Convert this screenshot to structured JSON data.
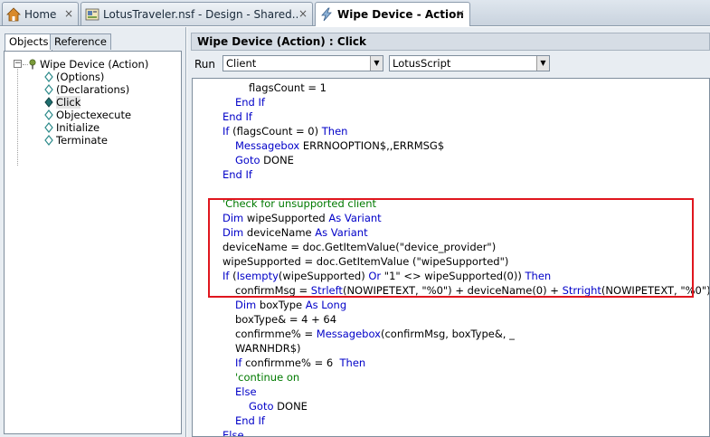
{
  "tabs": [
    {
      "label": "Home",
      "icon": "home-icon"
    },
    {
      "label": "LotusTraveler.nsf - Design - Shared...",
      "icon": "database-icon"
    },
    {
      "label": "Wipe Device - Action",
      "icon": "lightning-icon"
    }
  ],
  "left_panel": {
    "tabs": [
      "Objects",
      "Reference"
    ],
    "tree": {
      "root": "Wipe Device (Action)",
      "children": [
        "(Options)",
        "(Declarations)",
        "Click",
        "Objectexecute",
        "Initialize",
        "Terminate"
      ],
      "selected": "Click"
    }
  },
  "editor": {
    "title": "Wipe Device (Action) : Click",
    "run_label": "Run",
    "run_value": "Client",
    "language_value": "LotusScript"
  },
  "code_lines": [
    [
      {
        "t": "flagsCount = 1",
        "c": "n"
      }
    ],
    [
      {
        "t": "End If",
        "c": "k"
      }
    ],
    [
      {
        "t": "End If",
        "c": "k"
      }
    ],
    [
      {
        "t": "If",
        "c": "k"
      },
      {
        "t": " (flagsCount = 0) ",
        "c": "n"
      },
      {
        "t": "Then",
        "c": "k"
      }
    ],
    [
      {
        "t": "Messagebox",
        "c": "k"
      },
      {
        "t": " ERRNOOPTION$,,ERRMSG$",
        "c": "n"
      }
    ],
    [
      {
        "t": "Goto",
        "c": "k"
      },
      {
        "t": " DONE",
        "c": "n"
      }
    ],
    [
      {
        "t": "End If",
        "c": "k"
      }
    ],
    [],
    [
      {
        "t": "'Check for unsupported client",
        "c": "c"
      }
    ],
    [
      {
        "t": "Dim",
        "c": "k"
      },
      {
        "t": " wipeSupported ",
        "c": "n"
      },
      {
        "t": "As Variant",
        "c": "k"
      }
    ],
    [
      {
        "t": "Dim",
        "c": "k"
      },
      {
        "t": " deviceName ",
        "c": "n"
      },
      {
        "t": "As Variant",
        "c": "k"
      }
    ],
    [
      {
        "t": "deviceName = doc.GetItemValue(\"device_provider\")",
        "c": "n"
      }
    ],
    [
      {
        "t": "wipeSupported = doc.GetItemValue (\"wipeSupported\")",
        "c": "n"
      }
    ],
    [
      {
        "t": "If",
        "c": "k"
      },
      {
        "t": " (",
        "c": "n"
      },
      {
        "t": "Isempty",
        "c": "k"
      },
      {
        "t": "(wipeSupported) ",
        "c": "n"
      },
      {
        "t": "Or",
        "c": "k"
      },
      {
        "t": " \"1\" <> wipeSupported(0)) ",
        "c": "n"
      },
      {
        "t": "Then",
        "c": "k"
      }
    ],
    [
      {
        "t": "confirmMsg = ",
        "c": "n"
      },
      {
        "t": "Strleft",
        "c": "k"
      },
      {
        "t": "(NOWIPETEXT, \"%0\") + deviceName(0) + ",
        "c": "n"
      },
      {
        "t": "Strright",
        "c": "k"
      },
      {
        "t": "(NOWIPETEXT, \"%0\")",
        "c": "n"
      }
    ],
    [
      {
        "t": "Dim",
        "c": "k"
      },
      {
        "t": " boxType ",
        "c": "n"
      },
      {
        "t": "As Long",
        "c": "k"
      }
    ],
    [
      {
        "t": "boxType& = 4 + 64",
        "c": "n"
      }
    ],
    [
      {
        "t": "confirmme% = ",
        "c": "n"
      },
      {
        "t": "Messagebox",
        "c": "k"
      },
      {
        "t": "(confirmMsg, boxType&, _",
        "c": "n"
      }
    ],
    [
      {
        "t": "WARNHDR$)",
        "c": "n"
      }
    ],
    [
      {
        "t": "If",
        "c": "k"
      },
      {
        "t": " confirmme% = 6  ",
        "c": "n"
      },
      {
        "t": "Then",
        "c": "k"
      }
    ],
    [
      {
        "t": "'continue on",
        "c": "c"
      }
    ],
    [
      {
        "t": "Else",
        "c": "k"
      }
    ],
    [
      {
        "t": "Goto",
        "c": "k"
      },
      {
        "t": " DONE",
        "c": "n"
      }
    ],
    [
      {
        "t": "End If",
        "c": "k"
      }
    ],
    [
      {
        "t": "Else",
        "c": "k"
      }
    ]
  ]
}
